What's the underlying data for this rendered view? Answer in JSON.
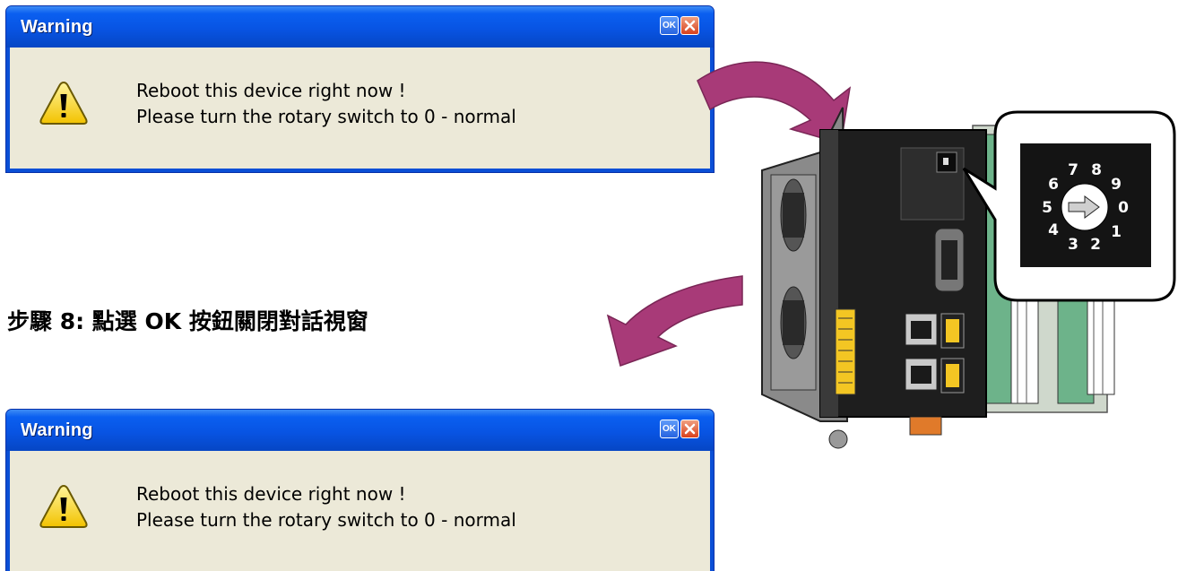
{
  "dialog_top": {
    "title": "Warning",
    "ok_label": "OK",
    "message_line1": "Reboot this device right now !",
    "message_line2": "Please turn the rotary switch to 0 - normal"
  },
  "dialog_bottom": {
    "title": "Warning",
    "ok_label": "OK",
    "message_line1": "Reboot this device right now !",
    "message_line2": "Please turn the rotary switch to 0 - normal"
  },
  "step_caption": "步驟 8: 點選 OK 按鈕關閉對話視窗",
  "rotary_switch": {
    "digits": [
      "0",
      "1",
      "2",
      "3",
      "4",
      "5",
      "6",
      "7",
      "8",
      "9"
    ]
  },
  "colors": {
    "titlebar": "#0a5ff0",
    "client": "#ece9d8",
    "arrow": "#a83a78",
    "device_body": "#1e1e1e",
    "device_frame": "#8a8a8a",
    "rail": "#6db38a",
    "terminal": "#f3c623"
  },
  "icons": [
    "warning-icon",
    "ok-button",
    "close-icon",
    "curved-arrow"
  ]
}
